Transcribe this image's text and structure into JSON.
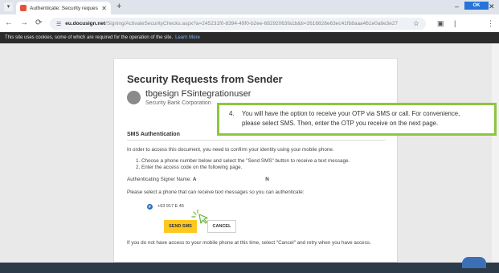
{
  "browser": {
    "tab_title": "Authenticate: Security requests",
    "url_host": "eu.docusign.net",
    "url_path": "/Signing/ActivateSecurityChecks.aspx?a=245231f0-8394-49f0-b2ee-68292063fa1b&ti=2616828e63ec41fb8aaa461e0a8e3e27"
  },
  "cookie_banner": {
    "text": "This site uses cookies, some of which are required for the operation of the site.",
    "link": "Learn More",
    "ok": "OK"
  },
  "dialog": {
    "title": "Security Requests from Sender",
    "sender_name": "tbgesign FSintegrationuser",
    "sender_org": "Security Bank Corporation",
    "section_title": "SMS Authentication",
    "intro": "In order to access this document, you need to confirm your identity using your mobile phone.",
    "steps": [
      "1. Choose a phone number below and select the \"Send SMS\" button to receive a text message.",
      "2. Enter the access code on the following page."
    ],
    "signer_label": "Authenticating Signer Name:",
    "signer_first": "A",
    "signer_last": "N",
    "phone_prompt": "Please select a phone that can receive text messages so you can authenticate:",
    "phone_number": "+63 917 E        45",
    "send_button": "SEND SMS",
    "cancel_button": "CANCEL",
    "footer": "If you do not have access to your mobile phone at this time, select \"Cancel\" and retry when you have access."
  },
  "callout": {
    "number": "4.",
    "line1": "You will have the option to receive your OTP via SMS or call. For convenience,",
    "line2": "please select SMS. Then, enter the OTP you receive on the next page."
  },
  "colors": {
    "accent_button": "#ffc820",
    "callout_border": "#8dc63f",
    "cookie_ok": "#2673d9"
  }
}
